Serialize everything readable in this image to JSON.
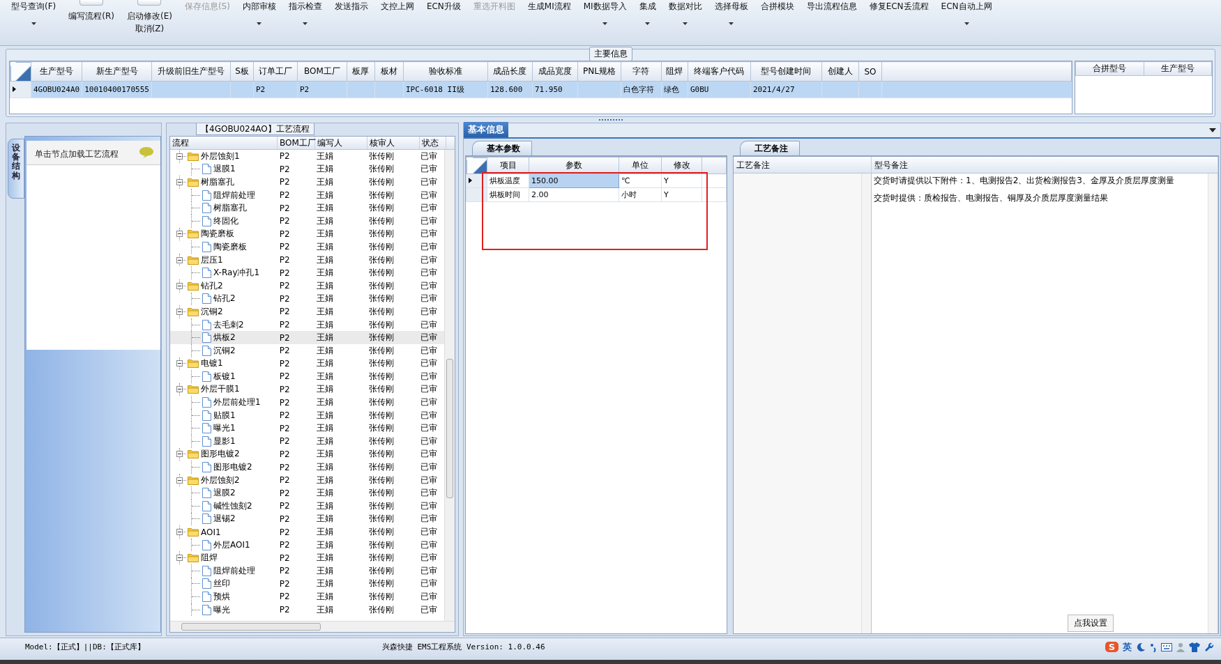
{
  "toolbar": {
    "items": [
      {
        "kind": "button",
        "label": "型号查询(F)",
        "dropdown": true,
        "disabled": false
      },
      {
        "kind": "toggle",
        "label": "编写流程(R)",
        "on": false,
        "dropdown": false,
        "disabled": false
      },
      {
        "kind": "toggle",
        "label": "启动修改(E)",
        "on": false,
        "sub": "取消(Z)",
        "dropdown": false,
        "disabled": false
      },
      {
        "kind": "button",
        "label": "保存信息(S)",
        "dropdown": false,
        "disabled": true
      },
      {
        "kind": "button",
        "label": "内部审核",
        "dropdown": true,
        "disabled": false
      },
      {
        "kind": "button",
        "label": "指示检查",
        "dropdown": true,
        "disabled": false
      },
      {
        "kind": "button",
        "label": "发送指示",
        "dropdown": false,
        "disabled": false
      },
      {
        "kind": "button",
        "label": "文控上网",
        "dropdown": false,
        "disabled": false
      },
      {
        "kind": "button",
        "label": "ECN升级",
        "dropdown": false,
        "disabled": false
      },
      {
        "kind": "button",
        "label": "重选开料图",
        "dropdown": false,
        "disabled": true
      },
      {
        "kind": "button",
        "label": "生成MI流程",
        "dropdown": false,
        "disabled": false
      },
      {
        "kind": "button",
        "label": "MI数据导入",
        "dropdown": true,
        "disabled": false
      },
      {
        "kind": "button",
        "label": "集成",
        "dropdown": true,
        "disabled": false
      },
      {
        "kind": "button",
        "label": "数据对比",
        "dropdown": true,
        "disabled": false
      },
      {
        "kind": "button",
        "label": "选择母板",
        "dropdown": true,
        "disabled": false
      },
      {
        "kind": "button",
        "label": "合拼模块",
        "dropdown": false,
        "disabled": false
      },
      {
        "kind": "button",
        "label": "导出流程信息",
        "dropdown": false,
        "disabled": false
      },
      {
        "kind": "button",
        "label": "修复ECN丢流程",
        "dropdown": false,
        "disabled": false
      },
      {
        "kind": "button",
        "label": "ECN自动上网",
        "dropdown": true,
        "disabled": false
      }
    ]
  },
  "main_info": {
    "title": "主要信息",
    "row_selected": true,
    "columns": [
      {
        "header": "生产型号",
        "value": "4GOBU024A0"
      },
      {
        "header": "新生产型号",
        "value": "10010400170555"
      },
      {
        "header": "升级前旧生产型号"
      },
      {
        "header": "S板"
      },
      {
        "header": "订单工厂",
        "value": "P2"
      },
      {
        "header": "BOM工厂",
        "value": "P2"
      },
      {
        "header": "板厚"
      },
      {
        "header": "板材"
      },
      {
        "header": "验收标准",
        "value": "IPC-6018 II级"
      },
      {
        "header": "成品长度",
        "value": "128.600"
      },
      {
        "header": "成品宽度",
        "value": "71.950"
      },
      {
        "header": "PNL规格"
      },
      {
        "header": "字符",
        "value": "白色字符"
      },
      {
        "header": "阻焊",
        "value": "绿色"
      },
      {
        "header": "终端客户代码",
        "value": "G0BU"
      },
      {
        "header": "型号创建时间",
        "value": "2021/4/27"
      },
      {
        "header": "创建人"
      },
      {
        "header": "SO"
      }
    ],
    "side_columns": [
      "合拼型号",
      "生产型号"
    ]
  },
  "left_panel": {
    "vertical_tab": "设备结构",
    "hint": "单击节点加载工艺流程"
  },
  "process_tree": {
    "title": "【4GOBU024AO】工艺流程",
    "columns": [
      "流程",
      "BOM工厂",
      "编写人",
      "核审人",
      "状态"
    ],
    "nodes": [
      {
        "label": "外层蚀刻1",
        "bom": "P2",
        "writer": "王娟",
        "reviewer": "张传刚",
        "status": "已审",
        "selected": false,
        "expanded": true,
        "children": [
          {
            "label": "退膜1",
            "bom": "P2",
            "writer": "王娟",
            "reviewer": "张传刚",
            "status": "已审",
            "selected": false
          }
        ]
      },
      {
        "label": "树脂塞孔",
        "bom": "P2",
        "writer": "王娟",
        "reviewer": "张传刚",
        "status": "已审",
        "selected": false,
        "expanded": true,
        "children": [
          {
            "label": "阻焊前处理",
            "bom": "P2",
            "writer": "王娟",
            "reviewer": "张传刚",
            "status": "已审",
            "selected": false
          },
          {
            "label": "树脂塞孔",
            "bom": "P2",
            "writer": "王娟",
            "reviewer": "张传刚",
            "status": "已审",
            "selected": false
          },
          {
            "label": "终固化",
            "bom": "P2",
            "writer": "王娟",
            "reviewer": "张传刚",
            "status": "已审",
            "selected": false
          }
        ]
      },
      {
        "label": "陶瓷磨板",
        "bom": "P2",
        "writer": "王娟",
        "reviewer": "张传刚",
        "status": "已审",
        "selected": false,
        "expanded": true,
        "children": [
          {
            "label": "陶瓷磨板",
            "bom": "P2",
            "writer": "王娟",
            "reviewer": "张传刚",
            "status": "已审",
            "selected": false
          }
        ]
      },
      {
        "label": "层压1",
        "bom": "P2",
        "writer": "王娟",
        "reviewer": "张传刚",
        "status": "已审",
        "selected": false,
        "expanded": true,
        "children": [
          {
            "label": "X-Ray冲孔1",
            "bom": "P2",
            "writer": "王娟",
            "reviewer": "张传刚",
            "status": "已审",
            "selected": false
          }
        ]
      },
      {
        "label": "钻孔2",
        "bom": "P2",
        "writer": "王娟",
        "reviewer": "张传刚",
        "status": "已审",
        "selected": false,
        "expanded": true,
        "children": [
          {
            "label": "钻孔2",
            "bom": "P2",
            "writer": "王娟",
            "reviewer": "张传刚",
            "status": "已审",
            "selected": false
          }
        ]
      },
      {
        "label": "沉铜2",
        "bom": "P2",
        "writer": "王娟",
        "reviewer": "张传刚",
        "status": "已审",
        "selected": false,
        "expanded": true,
        "children": [
          {
            "label": "去毛刺2",
            "bom": "P2",
            "writer": "王娟",
            "reviewer": "张传刚",
            "status": "已审",
            "selected": false
          },
          {
            "label": "烘板2",
            "bom": "P2",
            "writer": "王娟",
            "reviewer": "张传刚",
            "status": "已审",
            "selected": true
          },
          {
            "label": "沉铜2",
            "bom": "P2",
            "writer": "王娟",
            "reviewer": "张传刚",
            "status": "已审",
            "selected": false
          }
        ]
      },
      {
        "label": "电镀1",
        "bom": "P2",
        "writer": "王娟",
        "reviewer": "张传刚",
        "status": "已审",
        "selected": false,
        "expanded": true,
        "children": [
          {
            "label": "板镀1",
            "bom": "P2",
            "writer": "王娟",
            "reviewer": "张传刚",
            "status": "已审",
            "selected": false
          }
        ]
      },
      {
        "label": "外层干膜1",
        "bom": "P2",
        "writer": "王娟",
        "reviewer": "张传刚",
        "status": "已审",
        "selected": false,
        "expanded": true,
        "children": [
          {
            "label": "外层前处理1",
            "bom": "P2",
            "writer": "王娟",
            "reviewer": "张传刚",
            "status": "已审",
            "selected": false
          },
          {
            "label": "贴膜1",
            "bom": "P2",
            "writer": "王娟",
            "reviewer": "张传刚",
            "status": "已审",
            "selected": false
          },
          {
            "label": "曝光1",
            "bom": "P2",
            "writer": "王娟",
            "reviewer": "张传刚",
            "status": "已审",
            "selected": false
          },
          {
            "label": "显影1",
            "bom": "P2",
            "writer": "王娟",
            "reviewer": "张传刚",
            "status": "已审",
            "selected": false
          }
        ]
      },
      {
        "label": "图形电镀2",
        "bom": "P2",
        "writer": "王娟",
        "reviewer": "张传刚",
        "status": "已审",
        "selected": false,
        "expanded": true,
        "children": [
          {
            "label": "图形电镀2",
            "bom": "P2",
            "writer": "王娟",
            "reviewer": "张传刚",
            "status": "已审",
            "selected": false
          }
        ]
      },
      {
        "label": "外层蚀刻2",
        "bom": "P2",
        "writer": "王娟",
        "reviewer": "张传刚",
        "status": "已审",
        "selected": false,
        "expanded": true,
        "children": [
          {
            "label": "退膜2",
            "bom": "P2",
            "writer": "王娟",
            "reviewer": "张传刚",
            "status": "已审",
            "selected": false
          },
          {
            "label": "碱性蚀刻2",
            "bom": "P2",
            "writer": "王娟",
            "reviewer": "张传刚",
            "status": "已审",
            "selected": false
          },
          {
            "label": "退锡2",
            "bom": "P2",
            "writer": "王娟",
            "reviewer": "张传刚",
            "status": "已审",
            "selected": false
          }
        ]
      },
      {
        "label": "AOI1",
        "bom": "P2",
        "writer": "王娟",
        "reviewer": "张传刚",
        "status": "已审",
        "selected": false,
        "expanded": true,
        "children": [
          {
            "label": "外层AOI1",
            "bom": "P2",
            "writer": "王娟",
            "reviewer": "张传刚",
            "status": "已审",
            "selected": false
          }
        ]
      },
      {
        "label": "阻焊",
        "bom": "P2",
        "writer": "王娟",
        "reviewer": "张传刚",
        "status": "已审",
        "selected": false,
        "expanded": true,
        "children": [
          {
            "label": "阻焊前处理",
            "bom": "P2",
            "writer": "王娟",
            "reviewer": "张传刚",
            "status": "已审",
            "selected": false
          },
          {
            "label": "丝印",
            "bom": "P2",
            "writer": "王娟",
            "reviewer": "张传刚",
            "status": "已审",
            "selected": false
          },
          {
            "label": "预烘",
            "bom": "P2",
            "writer": "王娟",
            "reviewer": "张传刚",
            "status": "已审",
            "selected": false
          },
          {
            "label": "曝光",
            "bom": "P2",
            "writer": "王娟",
            "reviewer": "张传刚",
            "status": "已审",
            "selected": false
          }
        ]
      }
    ]
  },
  "detail": {
    "tabs": [
      {
        "label": "基本信息",
        "selected": true
      }
    ],
    "params": {
      "tab": "基本参数",
      "columns": [
        "项目",
        "参数",
        "单位",
        "修改"
      ],
      "rows": [
        {
          "item": "烘板温度",
          "value": "150.00",
          "unit": "℃",
          "modified": "Y",
          "selected": true
        },
        {
          "item": "烘板时间",
          "value": "2.00",
          "unit": "小时",
          "modified": "Y",
          "selected": false
        }
      ]
    },
    "notes": {
      "tab": "工艺备注",
      "columns": [
        "工艺备注",
        "型号备注"
      ],
      "model_notes": [
        "交货时请提供以下附件：1、电测报告2、出货检测报告3、金厚及介质层厚度测量",
        "交货时提供：质检报告、电测报告、铜厚及介质层厚度测量结果"
      ]
    }
  },
  "status_bar": {
    "left": "Model:【正式】||DB:【正式库】",
    "center": "兴森快捷 EMS工程系统 Version: 1.0.0.46",
    "tray_logo": "S",
    "tray_lang": "英",
    "popup_button": "点我设置"
  }
}
